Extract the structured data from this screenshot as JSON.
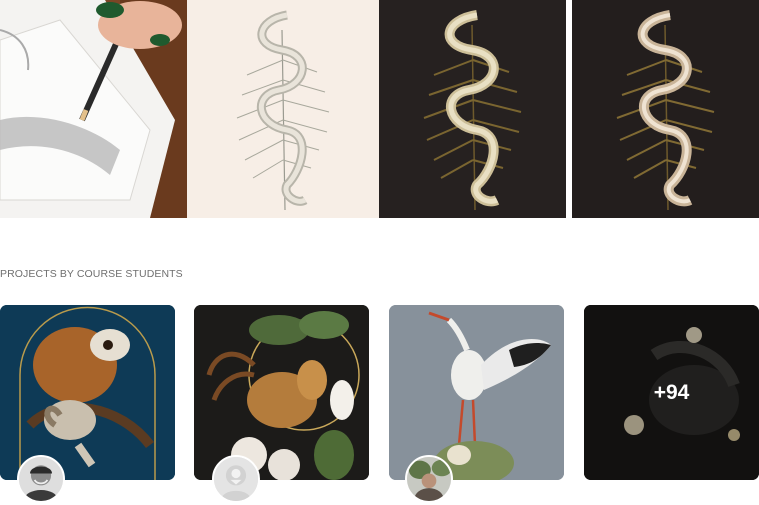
{
  "section": {
    "projects_label": "PROJECTS BY COURSE STUDENTS"
  },
  "projects": {
    "more_count": "+94"
  },
  "colors": {
    "page_background": "#ffffff",
    "label_text": "#6f6f6f",
    "overlay_text": "#ffffff"
  }
}
